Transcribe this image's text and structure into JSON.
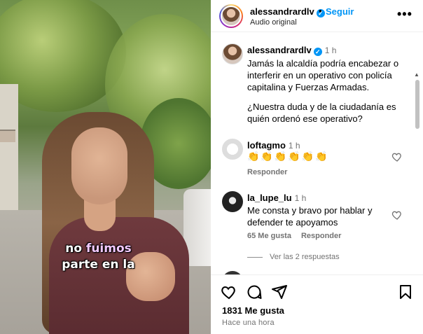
{
  "video": {
    "caption_line1_a": "no ",
    "caption_line1_b": "fuimos",
    "caption_line2": "parte en la"
  },
  "header": {
    "username": "alessandrardlv",
    "verified_mark": "✓",
    "separator": "•",
    "follow_label": "Seguir",
    "audio_label": "Audio original",
    "more_label": "•••"
  },
  "post": {
    "username": "alessandrardlv",
    "time": "1 h",
    "text_p1": "Jamás la alcaldía podría encabezar o interferir en un operativo con policía capitalina y Fuerzas Armadas.",
    "text_p2": "¿Nuestra duda y de la ciudadanía es quién ordenó ese operativo?"
  },
  "comments": [
    {
      "username": "loftagmo",
      "time": "1 h",
      "text": "👏👏👏👏👏👏",
      "reply_label": "Responder"
    },
    {
      "username": "la_lupe_lu",
      "time": "1 h",
      "text": "Me consta y bravo por hablar y defender te apoyamos",
      "likes_label": "65 Me gusta",
      "reply_label": "Responder",
      "view_replies": "Ver las 2 respuestas"
    }
  ],
  "footer": {
    "likes": "1831 Me gusta",
    "time_ago": "Hace una hora"
  },
  "icons": [
    "more-options-icon",
    "verified-icon",
    "heart-icon",
    "comment-icon",
    "share-icon",
    "bookmark-icon"
  ],
  "colors": {
    "accent": "#0095f6",
    "muted": "#737373",
    "text": "#000000"
  }
}
